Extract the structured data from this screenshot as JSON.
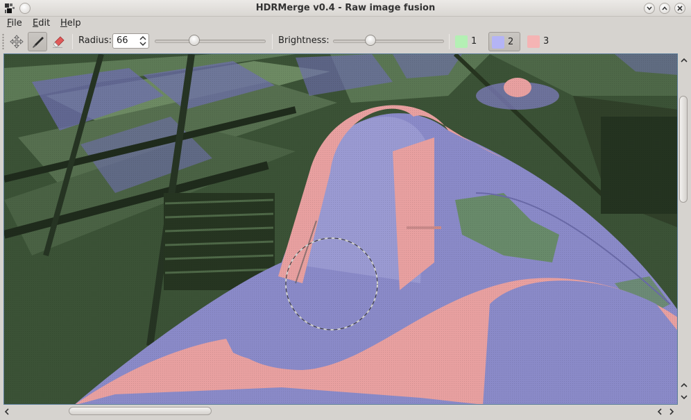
{
  "window": {
    "title": "HDRMerge v0.4 - Raw image fusion"
  },
  "menu": [
    {
      "key": "F",
      "rest": "ile"
    },
    {
      "key": "E",
      "rest": "dit"
    },
    {
      "key": "H",
      "rest": "elp"
    }
  ],
  "toolbar": {
    "radius_label": "Radius:",
    "radius_value": "66",
    "radius_slider_fraction": 0.34,
    "brightness_label": "Brightness:",
    "brightness_slider_fraction": 0.32,
    "active_tool": "brush",
    "layers": [
      {
        "label": "1",
        "color": "#b4f0b4"
      },
      {
        "label": "2",
        "color": "#b4b4f5",
        "active": true
      },
      {
        "label": "3",
        "color": "#f5b4b4"
      }
    ]
  },
  "colors": {
    "layer1_overlay": "#3e5a3a",
    "layer2_overlay": "#8a8ac8",
    "layer3_overlay": "#e8a0a0",
    "viewport_border": "#5a7d9a"
  }
}
